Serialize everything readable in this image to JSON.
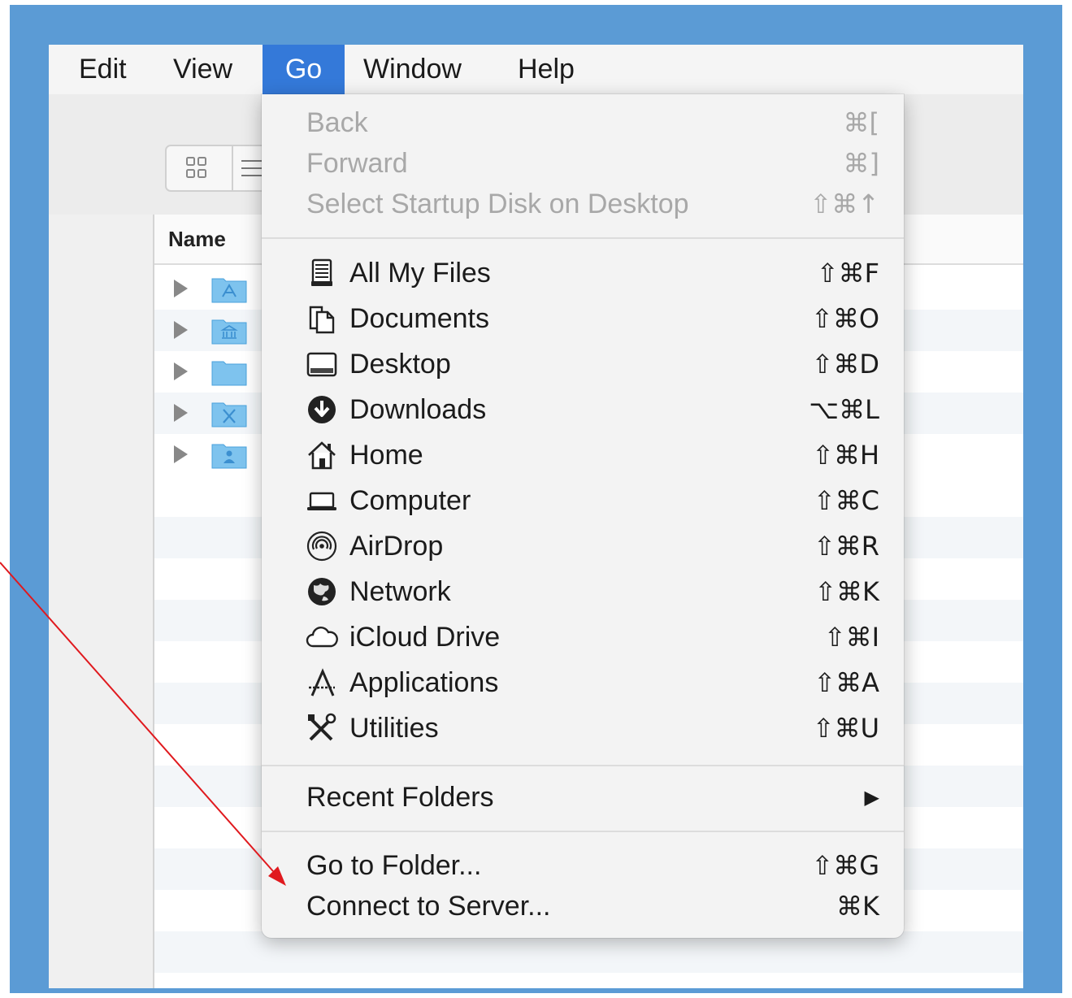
{
  "menubar": {
    "items": [
      {
        "label": "Edit"
      },
      {
        "label": "View"
      },
      {
        "label": "Go"
      },
      {
        "label": "Window"
      },
      {
        "label": "Help"
      }
    ]
  },
  "finder": {
    "column_name": "Name",
    "rows": [
      {
        "icon": "applications-folder-icon"
      },
      {
        "icon": "library-folder-icon"
      },
      {
        "icon": "folder-icon"
      },
      {
        "icon": "developer-folder-icon"
      },
      {
        "icon": "users-folder-icon"
      }
    ]
  },
  "go_menu": {
    "nav": [
      {
        "label": "Back",
        "shortcut": "⌘[",
        "enabled": false
      },
      {
        "label": "Forward",
        "shortcut": "⌘]",
        "enabled": false
      },
      {
        "label": "Select Startup Disk on Desktop",
        "shortcut": "⇧⌘↑",
        "enabled": false
      }
    ],
    "places": [
      {
        "label": "All My Files",
        "shortcut": "⇧⌘F",
        "icon": "all-my-files-icon"
      },
      {
        "label": "Documents",
        "shortcut": "⇧⌘O",
        "icon": "documents-icon"
      },
      {
        "label": "Desktop",
        "shortcut": "⇧⌘D",
        "icon": "desktop-icon"
      },
      {
        "label": "Downloads",
        "shortcut": "⌥⌘L",
        "icon": "downloads-icon"
      },
      {
        "label": "Home",
        "shortcut": "⇧⌘H",
        "icon": "home-icon"
      },
      {
        "label": "Computer",
        "shortcut": "⇧⌘C",
        "icon": "computer-icon"
      },
      {
        "label": "AirDrop",
        "shortcut": "⇧⌘R",
        "icon": "airdrop-icon"
      },
      {
        "label": "Network",
        "shortcut": "⇧⌘K",
        "icon": "network-icon"
      },
      {
        "label": "iCloud Drive",
        "shortcut": "⇧⌘I",
        "icon": "icloud-icon"
      },
      {
        "label": "Applications",
        "shortcut": "⇧⌘A",
        "icon": "applications-icon"
      },
      {
        "label": "Utilities",
        "shortcut": "⇧⌘U",
        "icon": "utilities-icon"
      }
    ],
    "recent": {
      "label": "Recent Folders",
      "submenu": "▶"
    },
    "tail": [
      {
        "label": "Go to Folder...",
        "shortcut": "⇧⌘G"
      },
      {
        "label": "Connect to Server...",
        "shortcut": "⌘K"
      }
    ]
  },
  "colors": {
    "frame": "#5b9bd5",
    "menu_highlight": "#3479d9",
    "annotation_arrow": "#e0191e"
  }
}
